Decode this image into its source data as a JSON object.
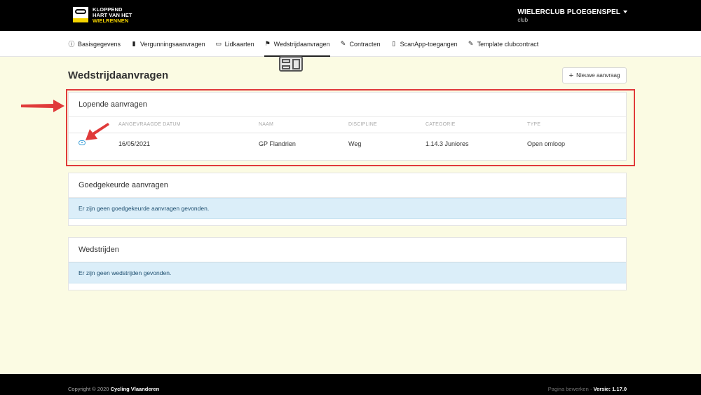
{
  "brand": {
    "line1": "KLOPPEND",
    "line2": "HART VAN HET",
    "line3": "WIELRENNEN"
  },
  "account": {
    "name": "WIELERCLUB PLOEGENSPEL",
    "role": "club"
  },
  "nav": [
    {
      "label": "Basisgegevens",
      "icon": "info-icon"
    },
    {
      "label": "Vergunningsaanvragen",
      "icon": "book-icon"
    },
    {
      "label": "Lidkaarten",
      "icon": "card-icon"
    },
    {
      "label": "Wedstrijdaanvragen",
      "icon": "flag-icon",
      "active": true
    },
    {
      "label": "Contracten",
      "icon": "signature-icon"
    },
    {
      "label": "ScanApp-toegangen",
      "icon": "phone-icon"
    },
    {
      "label": "Template clubcontract",
      "icon": "signature-icon"
    }
  ],
  "page": {
    "title": "Wedstrijdaanvragen",
    "new_button": "Nieuwe aanvraag"
  },
  "pending": {
    "title": "Lopende aanvragen",
    "columns": [
      "AANGEVRAAGDE DATUM",
      "NAAM",
      "DISCIPLINE",
      "CATEGORIE",
      "TYPE"
    ],
    "rows": [
      {
        "date": "16/05/2021",
        "name": "GP Flandrien",
        "discipline": "Weg",
        "category": "1.14.3 Juniores",
        "type": "Open omloop"
      }
    ]
  },
  "approved": {
    "title": "Goedgekeurde aanvragen",
    "empty": "Er zijn geen goedgekeurde aanvragen gevonden."
  },
  "races": {
    "title": "Wedstrijden",
    "empty": "Er zijn geen wedstrijden gevonden."
  },
  "footer": {
    "copyright_prefix": "Copyright © 2020",
    "copyright_org": "Cycling Vlaanderen",
    "edit_page": "Pagina bewerken",
    "version": "Versie: 1.17.0"
  },
  "colors": {
    "background": "#fbfbe3",
    "highlight": "#e03a3a",
    "info": "#dbeef9",
    "accent": "#f5d400"
  }
}
